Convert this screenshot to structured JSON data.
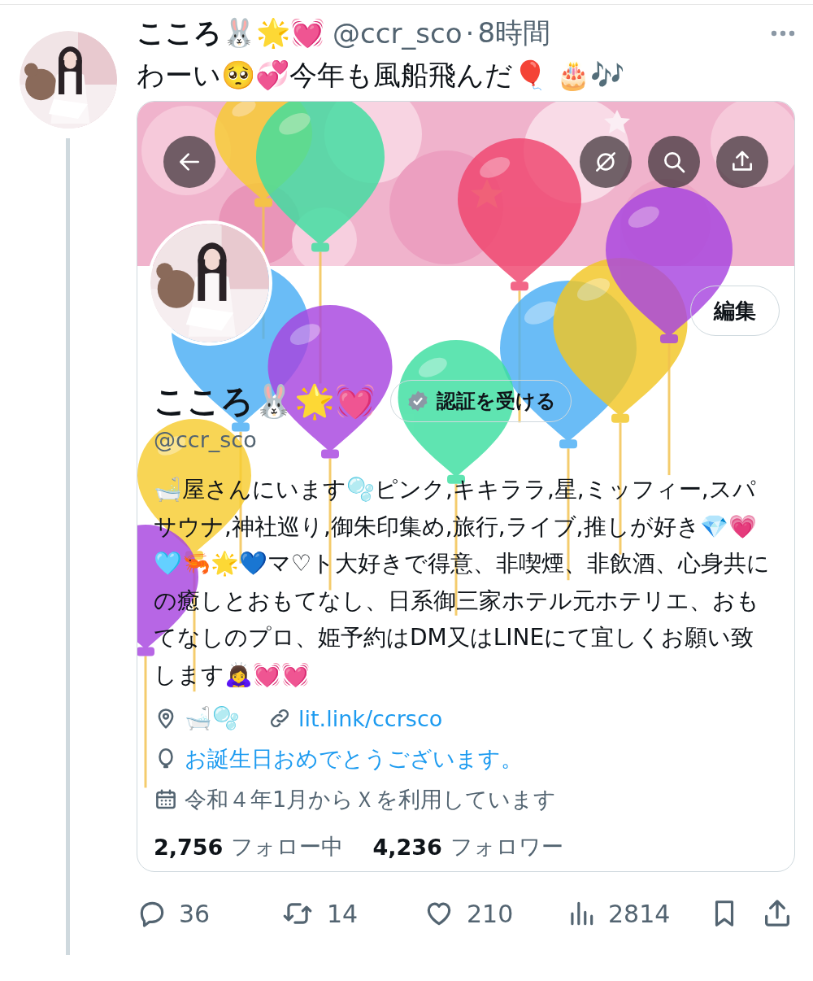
{
  "tweet": {
    "author": {
      "name": "こころ🐰🌟💓",
      "handle": "@ccr_sco",
      "separator": "·",
      "time": "8時間"
    },
    "text": "わーい🥺💞今年も風船飛んだ🎈 🎂🎶",
    "media": {
      "kind": "screenshot",
      "profile": {
        "edit_button": "編集",
        "name": "こころ🐰🌟💓",
        "verify_button": "認証を受ける",
        "handle": "@ccr_sco",
        "bio": "🛁屋さんにいます🫧ピンク,キキララ,星,ミッフィー,スパサウナ,神社巡り,御朱印集め,旅行,ライブ,推しが好き💎💗🩵🦐🌟💙マ♡ト大好きで得意、非喫煙、非飲酒、心身共にの癒しとおもてなし、日系御三家ホテル元ホテリエ、おもてなしのプロ、姫予約はDM又はLINEにて宜しくお願い致します🙇‍♀️💓💓",
        "location": "🛁🫧",
        "link": "lit.link/ccrsco",
        "birthday": "お誕生日おめでとうございます。",
        "joined": "令和４年1月からＸを利用しています",
        "following_count": "2,756",
        "following_label": "フォロー中",
        "followers_count": "4,236",
        "followers_label": "フォロワー"
      }
    },
    "actions": [
      {
        "kind": "reply",
        "count": "36"
      },
      {
        "kind": "repost",
        "count": "14"
      },
      {
        "kind": "like",
        "count": "210"
      },
      {
        "kind": "views",
        "count": "2814"
      },
      {
        "kind": "bookmark"
      },
      {
        "kind": "share"
      }
    ]
  }
}
